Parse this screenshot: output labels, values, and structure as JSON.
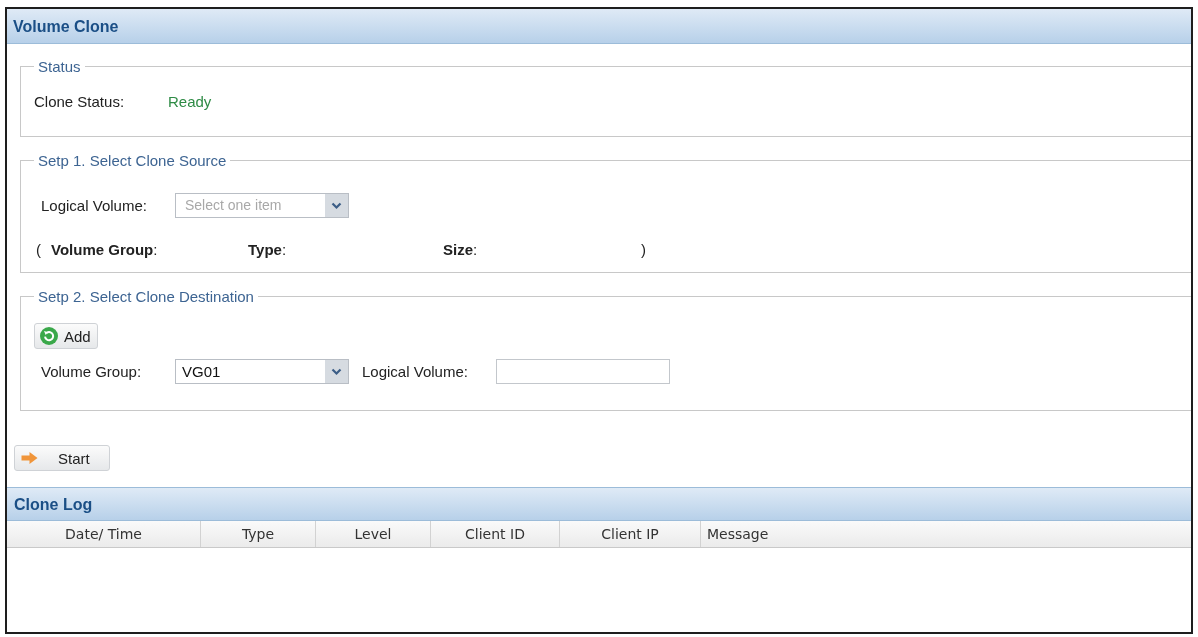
{
  "window": {
    "title": "Volume Clone"
  },
  "status": {
    "legend": "Status",
    "label": "Clone Status:",
    "value": "Ready"
  },
  "source": {
    "legend": "Setp 1. Select Clone Source",
    "field_label": "Logical Volume:",
    "select": {
      "placeholder": "Select one item"
    },
    "info": {
      "open": "(",
      "items": [
        "**Volume Group**:",
        "**Type**:",
        "**Size**:"
      ],
      "close": ")"
    }
  },
  "destination": {
    "legend": "Setp 2. Select Clone Destination",
    "add_button": "Add",
    "volume_group_label": "Volume Group:",
    "volume_group_value": "VG01",
    "logical_volume_label": "Logical Volume:"
  },
  "start_button": "Start",
  "log": {
    "title": "Clone Log",
    "columns": [
      "Date/ Time",
      "Type",
      "Level",
      "Client ID",
      "Client IP",
      "Message"
    ]
  }
}
